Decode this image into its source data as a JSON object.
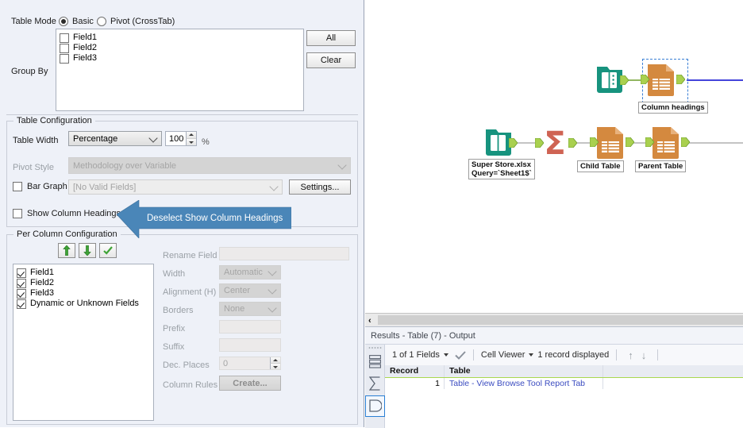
{
  "app": {
    "accent_blue": "#4a86b8",
    "node_orange": "#d4893f",
    "node_teal": "#17937e",
    "node_red": "#cf6353",
    "anchor_green": "#a9d04f",
    "selection_blue": "#3a7fd5"
  },
  "config_panel": {
    "table_mode": {
      "label": "Table Mode",
      "options": [
        {
          "label": "Basic",
          "selected": true
        },
        {
          "label": "Pivot (CrossTab)",
          "selected": false
        }
      ]
    },
    "group_by": {
      "label": "Group By",
      "fields": [
        {
          "label": "Field1",
          "checked": false
        },
        {
          "label": "Field2",
          "checked": false
        },
        {
          "label": "Field3",
          "checked": false
        }
      ],
      "buttons": [
        {
          "label": "All",
          "name": "all-button"
        },
        {
          "label": "Clear",
          "name": "clear-button"
        }
      ]
    },
    "table_configuration": {
      "title": "Table Configuration",
      "table_width": {
        "label": "Table Width",
        "mode_value": "Percentage",
        "amount_value": "100",
        "unit": "%"
      },
      "pivot_style": {
        "label": "Pivot Style",
        "value": "Methodology over Variable",
        "disabled": true
      },
      "bar_graph": {
        "label": "Bar Graph",
        "checked": false,
        "value": "[No Valid Fields]",
        "settings_label": "Settings..."
      },
      "show_column_headings": {
        "label": "Show Column Headings",
        "checked": false
      }
    },
    "per_column_configuration": {
      "title": "Per Column Configuration",
      "toolbar": [
        {
          "name": "move-up-button",
          "icon": "arrow-up-icon"
        },
        {
          "name": "move-down-button",
          "icon": "arrow-down-icon"
        },
        {
          "name": "check-all-button",
          "icon": "check-icon"
        }
      ],
      "fields": [
        {
          "label": "Field1",
          "checked": true
        },
        {
          "label": "Field2",
          "checked": true
        },
        {
          "label": "Field3",
          "checked": true
        },
        {
          "label": "Dynamic or Unknown Fields",
          "checked": true
        }
      ],
      "properties": {
        "rename_field": {
          "label": "Rename Field",
          "value": ""
        },
        "width": {
          "label": "Width",
          "value": "Automatic"
        },
        "alignment": {
          "label": "Alignment (H)",
          "value": "Center"
        },
        "borders": {
          "label": "Borders",
          "value": "None"
        },
        "prefix": {
          "label": "Prefix",
          "value": ""
        },
        "suffix": {
          "label": "Suffix",
          "value": ""
        },
        "dec_places": {
          "label": "Dec. Places",
          "value": "0"
        },
        "column_rules": {
          "label": "Column Rules",
          "button_label": "Create..."
        }
      }
    }
  },
  "callout": {
    "text": "Deselect Show Column Headings",
    "fill": "#4a86b8",
    "text_color": "#ffffff"
  },
  "canvas": {
    "nodes": [
      {
        "name": "browse-node-top",
        "icon": "browse-icon",
        "label": ""
      },
      {
        "name": "table-node-column-headings",
        "icon": "table-icon",
        "label": "Column headings",
        "selected": true
      },
      {
        "name": "input-node-super-store",
        "icon": "browse-icon",
        "label": "Super Store.xlsx\nQuery=`Sheet1$`"
      },
      {
        "name": "summarize-node",
        "icon": "sigma-icon",
        "label": ""
      },
      {
        "name": "table-node-child",
        "icon": "table-icon",
        "label": "Child Table"
      },
      {
        "name": "table-node-parent",
        "icon": "table-icon",
        "label": "Parent Table"
      }
    ]
  },
  "results": {
    "title": "Results - Table (7) - Output",
    "side_icons": [
      {
        "name": "messages-icon"
      },
      {
        "name": "sigma-icon"
      },
      {
        "name": "output-anchor-icon",
        "selected": true
      }
    ],
    "toolbar": {
      "fields_label": "1 of 1 Fields",
      "check_icon": "check-icon",
      "viewer_label": "Cell Viewer",
      "records_label": "1 record displayed",
      "up_icon": "arrow-up-icon",
      "down_icon": "arrow-down-icon"
    },
    "grid": {
      "columns": [
        "Record",
        "Table"
      ],
      "rows": [
        {
          "record": "1",
          "table": "Table - View Browse Tool Report Tab"
        }
      ]
    }
  }
}
